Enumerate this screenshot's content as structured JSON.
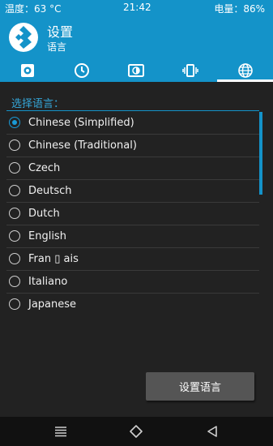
{
  "status": {
    "temp": "温度：63 °C",
    "time": "21:42",
    "battery": "电量：86%"
  },
  "header": {
    "title": "设置",
    "subtitle": "语言"
  },
  "tabs": [
    {
      "icon": "gear-icon",
      "active": false
    },
    {
      "icon": "clock-icon",
      "active": false
    },
    {
      "icon": "brightness-icon",
      "active": false
    },
    {
      "icon": "vibrate-icon",
      "active": false
    },
    {
      "icon": "globe-icon",
      "active": true
    }
  ],
  "language_section": {
    "label": "选择语言："
  },
  "languages": [
    {
      "label": "Chinese (Simplified)",
      "checked": true
    },
    {
      "label": "Chinese (Traditional)",
      "checked": false
    },
    {
      "label": "Czech",
      "checked": false
    },
    {
      "label": "Deutsch",
      "checked": false
    },
    {
      "label": "Dutch",
      "checked": false
    },
    {
      "label": "English",
      "checked": false
    },
    {
      "label": "Fran ▯ ais",
      "checked": false
    },
    {
      "label": "Italiano",
      "checked": false
    },
    {
      "label": "Japanese",
      "checked": false
    }
  ],
  "action": {
    "label": "设置语言"
  },
  "colors": {
    "accent": "#1493c9",
    "background": "#222222",
    "button": "#555555"
  },
  "navbar": {
    "icons": [
      "menu-icon",
      "home-icon",
      "back-icon"
    ]
  }
}
